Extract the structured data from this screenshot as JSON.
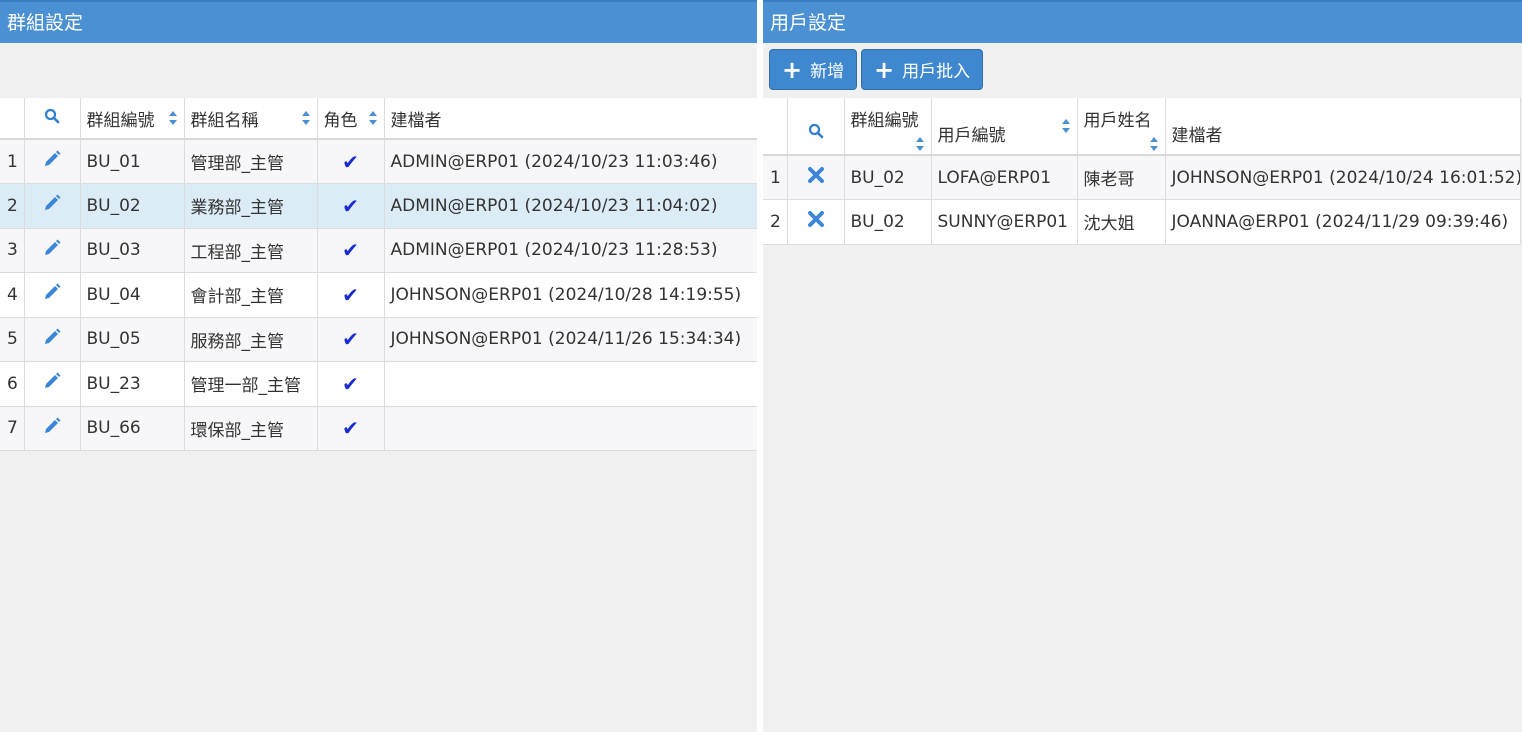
{
  "left_panel": {
    "title": "群組設定",
    "columns": [
      "",
      "",
      "群組編號",
      "群組名稱",
      "角色",
      "建檔者"
    ],
    "rows": [
      {
        "num": "1",
        "code": "BU_01",
        "name": "管理部_主管",
        "creator": "ADMIN@ERP01 (2024/10/23 11:03:46)"
      },
      {
        "num": "2",
        "code": "BU_02",
        "name": "業務部_主管",
        "creator": "ADMIN@ERP01 (2024/10/23 11:04:02)"
      },
      {
        "num": "3",
        "code": "BU_03",
        "name": "工程部_主管",
        "creator": "ADMIN@ERP01 (2024/10/23 11:28:53)"
      },
      {
        "num": "4",
        "code": "BU_04",
        "name": "會計部_主管",
        "creator": "JOHNSON@ERP01 (2024/10/28 14:19:55)"
      },
      {
        "num": "5",
        "code": "BU_05",
        "name": "服務部_主管",
        "creator": "JOHNSON@ERP01 (2024/11/26 15:34:34)"
      },
      {
        "num": "6",
        "code": "BU_23",
        "name": "管理一部_主管",
        "creator": ""
      },
      {
        "num": "7",
        "code": "BU_66",
        "name": "環保部_主管",
        "creator": ""
      }
    ],
    "selected_row": 2
  },
  "right_panel": {
    "title": "用戶設定",
    "add_label": "新增",
    "batch_label": "用戶批入",
    "columns": [
      "",
      "",
      "群組編號",
      "用戶編號",
      "用戶姓名",
      "建檔者"
    ],
    "rows": [
      {
        "num": "1",
        "group": "BU_02",
        "user_id": "LOFA@ERP01",
        "user_name": "陳老哥",
        "creator": "JOHNSON@ERP01 (2024/10/24 16:01:52)"
      },
      {
        "num": "2",
        "group": "BU_02",
        "user_id": "SUNNY@ERP01",
        "user_name": "沈大姐",
        "creator": "JOANNA@ERP01 (2024/11/29 09:39:46)"
      }
    ]
  },
  "icons": {
    "search": "search-icon",
    "edit": "pencil-icon",
    "check": "checkmark-icon",
    "delete": "x-icon",
    "sort": "sort-icon"
  },
  "colors": {
    "titlebar": "#4a90d2",
    "button": "#3f88d0",
    "selected_row": "#dcecf7",
    "check": "#1a2bd0",
    "icon_blue": "#3b86d6"
  }
}
